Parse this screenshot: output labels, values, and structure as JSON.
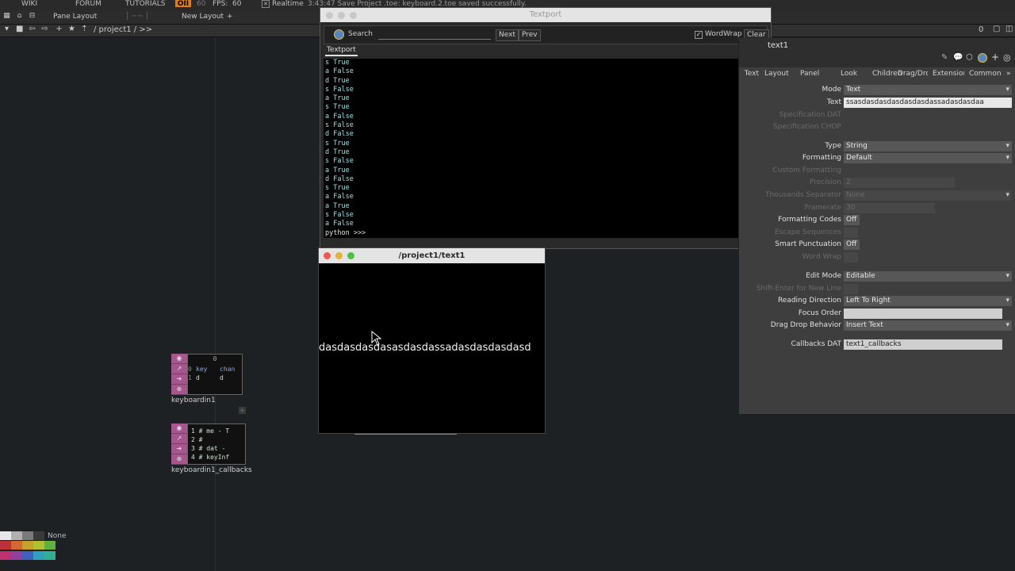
{
  "menu": {
    "items": [
      "WIKI",
      "FORUM",
      "TUTORIALS"
    ],
    "fps_label": "FPS:",
    "fps_value": "60",
    "fps_target": "60",
    "realtime_label": "Realtime",
    "status_message": "3:43:47 Save Project .toe: keyboard.2.toe saved successfully."
  },
  "layout_bar": {
    "pane_layout": "Pane Layout",
    "new_layout": "New Layout",
    "add": "+"
  },
  "path_bar": {
    "path": "/ project1 / >>",
    "right_counter": "0"
  },
  "nodes": {
    "keyboardin1": {
      "label": "keyboardin1",
      "header": "0",
      "rows": [
        [
          "0",
          "key",
          "chan"
        ],
        [
          "1",
          "d",
          "d"
        ]
      ]
    },
    "callbacks": {
      "label": "keyboardin1_callbacks",
      "lines": [
        "1  # me - T",
        "2  #",
        "3  # dat -",
        "4  # keyInf"
      ]
    }
  },
  "textport": {
    "title": "Textport",
    "search_label": "Search",
    "search_value": "",
    "next_label": "Next",
    "prev_label": "Prev",
    "wordwrap_label": "WordWrap",
    "wordwrap_checked": true,
    "clear_label": "Clear",
    "tab_label": "Textport",
    "lines": [
      "s True",
      "a False",
      "d True",
      "s False",
      "a True",
      "s True",
      "a False",
      "s False",
      "d False",
      "s True",
      "d True",
      "s False",
      "a True",
      "d False",
      "s True",
      "a False",
      "a True",
      "s False",
      "a False",
      "python >>>"
    ]
  },
  "viewer": {
    "title": "/project1/text1",
    "text": "dasdasdasdasasdasdassadasdasdasdasd"
  },
  "params": {
    "op_name": "text1",
    "tabs": [
      "Text",
      "Layout",
      "Panel",
      "Look",
      "Children",
      "Drag/Drop",
      "Extensions",
      "Common"
    ],
    "mode": {
      "label": "Mode",
      "value": "Text"
    },
    "text": {
      "label": "Text",
      "value": "ssasdasdasdasdasdasdassadasdasdaa"
    },
    "spec_dat": {
      "label": "Specification DAT"
    },
    "spec_chop": {
      "label": "Specification CHOP"
    },
    "type": {
      "label": "Type",
      "value": "String"
    },
    "formatting": {
      "label": "Formatting",
      "value": "Default"
    },
    "custom_formatting": {
      "label": "Custom Formatting"
    },
    "precision": {
      "label": "Precision",
      "value": "2"
    },
    "thousands_sep": {
      "label": "Thousands Separator",
      "value": "None"
    },
    "framerate": {
      "label": "Framerate",
      "value": "30"
    },
    "formatting_codes": {
      "label": "Formatting Codes",
      "value": "Off"
    },
    "escape_seq": {
      "label": "Escape Sequences"
    },
    "smart_punct": {
      "label": "Smart Punctuation",
      "value": "Off"
    },
    "word_wrap": {
      "label": "Word Wrap"
    },
    "edit_mode": {
      "label": "Edit Mode",
      "value": "Editable"
    },
    "shift_enter": {
      "label": "Shift-Enter for New Line"
    },
    "reading_dir": {
      "label": "Reading Direction",
      "value": "Left To Right"
    },
    "focus_order": {
      "label": "Focus Order",
      "value": ""
    },
    "drag_drop": {
      "label": "Drag Drop Behavior",
      "value": "Insert Text"
    },
    "callbacks_dat": {
      "label": "Callbacks DAT",
      "value": "text1_callbacks"
    }
  },
  "palette": {
    "none_label": "None",
    "row1": [
      "#e8e8e8",
      "#b0b0b0",
      "#7a7a7a",
      "#3a3a3a"
    ],
    "row2": [
      "#c0303a",
      "#d06a30",
      "#c8a030",
      "#b0c030",
      "#60b040"
    ],
    "row3": [
      "#c03070",
      "#9040a0",
      "#4060c0",
      "#30a0c0",
      "#30b090"
    ]
  }
}
